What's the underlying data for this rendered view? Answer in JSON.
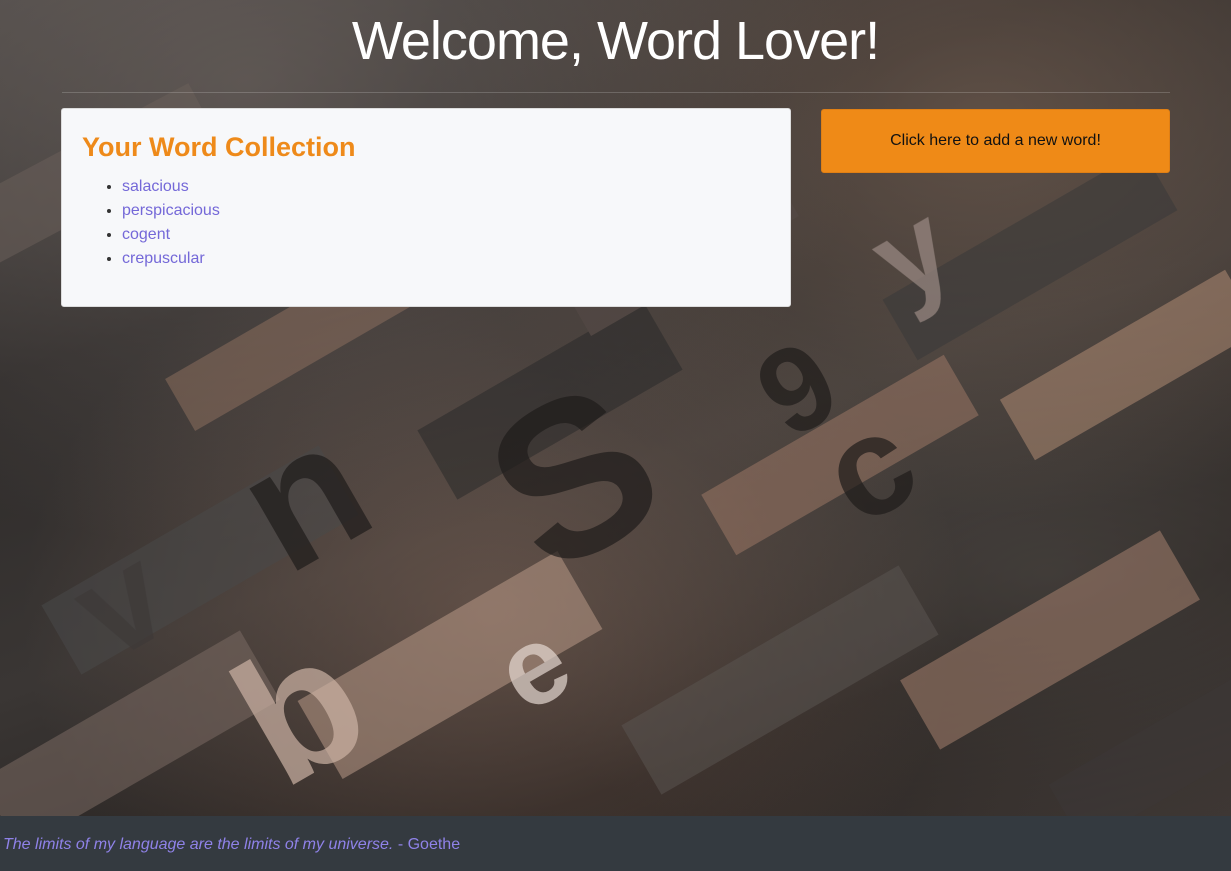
{
  "header": {
    "title": "Welcome, Word Lover!"
  },
  "collection": {
    "heading": "Your Word Collection",
    "words": [
      "salacious",
      "perspicacious",
      "cogent",
      "crepuscular"
    ]
  },
  "actions": {
    "add_word_label": "Click here to add a new word!"
  },
  "footer": {
    "quote": "The limits of my language are the limits of my universe.",
    "attribution": "- Goethe"
  },
  "colors": {
    "accent": "#ef8a17",
    "link": "#7468d8",
    "footer_bg": "#343a40"
  }
}
